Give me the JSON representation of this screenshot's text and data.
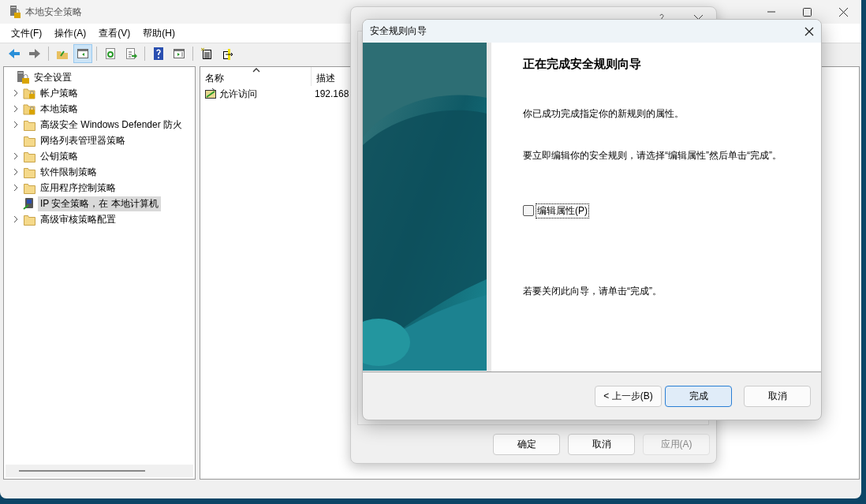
{
  "main_window": {
    "title": "本地安全策略",
    "menu": [
      "文件(F)",
      "操作(A)",
      "查看(V)",
      "帮助(H)"
    ],
    "toolbar": [
      {
        "kind": "back",
        "pressed": false
      },
      {
        "kind": "forward",
        "pressed": false
      },
      {
        "kind": "separator"
      },
      {
        "kind": "up",
        "pressed": false
      },
      {
        "kind": "tree-toggle",
        "pressed": true
      },
      {
        "kind": "separator"
      },
      {
        "kind": "refresh",
        "pressed": false
      },
      {
        "kind": "export",
        "pressed": false
      },
      {
        "kind": "separator"
      },
      {
        "kind": "help",
        "pressed": false
      },
      {
        "kind": "action-pane",
        "pressed": false
      },
      {
        "kind": "separator"
      },
      {
        "kind": "new",
        "pressed": false
      },
      {
        "kind": "move",
        "pressed": false
      }
    ],
    "tree": [
      {
        "label": "安全设置",
        "kind": "root",
        "selected": false,
        "children": [
          {
            "label": "帐户策略",
            "kind": "locked-folder",
            "selected": false,
            "expanded": false
          },
          {
            "label": "本地策略",
            "kind": "locked-folder",
            "selected": false,
            "expanded": false
          },
          {
            "label": "高级安全 Windows Defender 防火",
            "kind": "folder",
            "selected": false,
            "expanded": false
          },
          {
            "label": "网络列表管理器策略",
            "kind": "folder",
            "selected": false
          },
          {
            "label": "公钥策略",
            "kind": "folder",
            "selected": false,
            "expanded": false
          },
          {
            "label": "软件限制策略",
            "kind": "folder",
            "selected": false,
            "expanded": false
          },
          {
            "label": "应用程序控制策略",
            "kind": "folder",
            "selected": false,
            "expanded": false
          },
          {
            "label": "IP 安全策略，在 本地计算机",
            "kind": "ip-policy",
            "selected": true
          },
          {
            "label": "高级审核策略配置",
            "kind": "folder",
            "selected": false,
            "expanded": false
          }
        ]
      }
    ],
    "list": {
      "columns": [
        {
          "label": "名称",
          "sorted": true
        },
        {
          "label": "描述"
        }
      ],
      "rows": [
        {
          "name": "允许访问",
          "description": "192.168"
        }
      ]
    }
  },
  "properties_dialog": {
    "buttons": [
      {
        "label": "确定",
        "disabled": false
      },
      {
        "label": "取消",
        "disabled": false
      },
      {
        "label": "应用(A)",
        "disabled": true
      }
    ]
  },
  "wizard": {
    "title": "安全规则向导",
    "heading": "正在完成安全规则向导",
    "paragraphs": [
      "你已成功完成指定你的新规则的属性。",
      "要立即编辑你的安全规则，请选择“编辑属性”然后单击“完成”。"
    ],
    "checkbox": {
      "label": "编辑属性(P)",
      "checked": false
    },
    "closing_text": "若要关闭此向导，请单击“完成”。",
    "buttons": [
      {
        "label": "< 上一步(B)",
        "default": false
      },
      {
        "label": "完成",
        "default": true
      },
      {
        "label": "取消",
        "default": false
      }
    ]
  }
}
